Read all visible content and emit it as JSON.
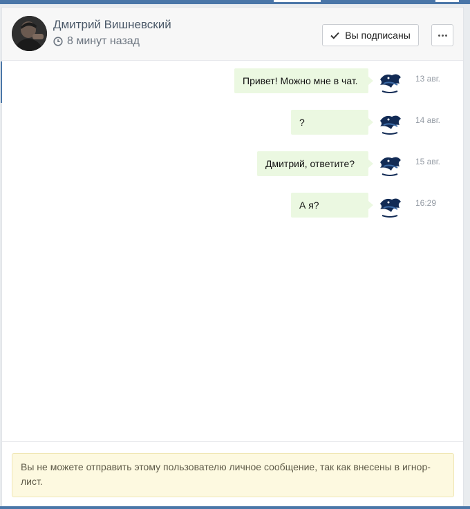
{
  "header": {
    "name": "Дмитрий Вишневский",
    "last_seen": "8 минут назад",
    "subscribe_label": "Вы подписаны"
  },
  "messages": [
    {
      "text": "Привет! Можно мне в чат.",
      "time": "13 авг."
    },
    {
      "text": "?",
      "time": "14 авг."
    },
    {
      "text": "Дмитрий, ответите?",
      "time": "15 авг."
    },
    {
      "text": "А я?",
      "time": "16:29"
    }
  ],
  "notice": {
    "text": "Вы не можете отправить этому пользователю личное сообщение, так как внесены в игнор-лист."
  },
  "icons": {
    "clock": "clock-icon",
    "check": "check-icon",
    "more": "more-icon"
  },
  "colors": {
    "accent": "#4a76a8",
    "bubble": "#ebf8e1",
    "notice_bg": "#fdf9e0"
  }
}
